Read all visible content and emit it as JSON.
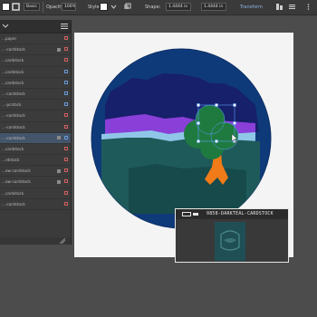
{
  "toolbar": {
    "style_label": "Basic",
    "opacity_label": "Opacity:",
    "opacity_value": "100%",
    "style_text": "Style:",
    "shape_label": "Shape:",
    "coord_w": "1.4444 in",
    "coord_h": "1.4444 in",
    "transform_label": "Transform",
    "fill_color": "#ffffff",
    "stroke_color": "#2a2a2a"
  },
  "layers_panel": {
    "rows": [
      {
        "label": "...paper",
        "chip": false,
        "box_color": "#d26060",
        "selected": false
      },
      {
        "label": "...-cardstock",
        "chip": true,
        "box_color": "#d26060",
        "selected": false
      },
      {
        "label": "...cardstock",
        "chip": false,
        "box_color": "#d26060",
        "selected": false
      },
      {
        "label": "...cardstock",
        "chip": false,
        "box_color": "#6a9ad6",
        "selected": false
      },
      {
        "label": "...cardstock",
        "chip": false,
        "box_color": "#6a9ad6",
        "selected": false
      },
      {
        "label": "...-cardstock",
        "chip": false,
        "box_color": "#6a9ad6",
        "selected": false
      },
      {
        "label": "...-pcstock",
        "chip": false,
        "box_color": "#6a9ad6",
        "selected": false
      },
      {
        "label": "...-cardstock",
        "chip": false,
        "box_color": "#d26060",
        "selected": false
      },
      {
        "label": "...-cardstock",
        "chip": false,
        "box_color": "#d26060",
        "selected": false
      },
      {
        "label": "...-cardstock",
        "chip": true,
        "box_color": "#6a9ad6",
        "selected": true
      },
      {
        "label": "...cardstock",
        "chip": false,
        "box_color": "#d26060",
        "selected": false
      },
      {
        "label": "...rdstock",
        "chip": false,
        "box_color": "#d26060",
        "selected": false
      },
      {
        "label": "...ow-cardstock",
        "chip": true,
        "box_color": "#d26060",
        "selected": false
      },
      {
        "label": "...ow-cardstock",
        "chip": true,
        "box_color": "#d26060",
        "selected": false
      },
      {
        "label": "...cardstock",
        "chip": false,
        "box_color": "#d26060",
        "selected": false
      },
      {
        "label": "...-cardstock",
        "chip": false,
        "box_color": "#d26060",
        "selected": false
      }
    ]
  },
  "preview": {
    "title": "0858-DARKTEAL-CARDSTOCK"
  },
  "colors": {
    "ocean": "#0f3a7a",
    "navy": "#17206a",
    "purple": "#8a3fd8",
    "light_blue": "#8fc6e8",
    "teal": "#1f5a5a",
    "dark_teal": "#174a4a",
    "moon": "#ee7b1f",
    "tree": "#1f7a3f",
    "trunk": "#f07b18"
  }
}
